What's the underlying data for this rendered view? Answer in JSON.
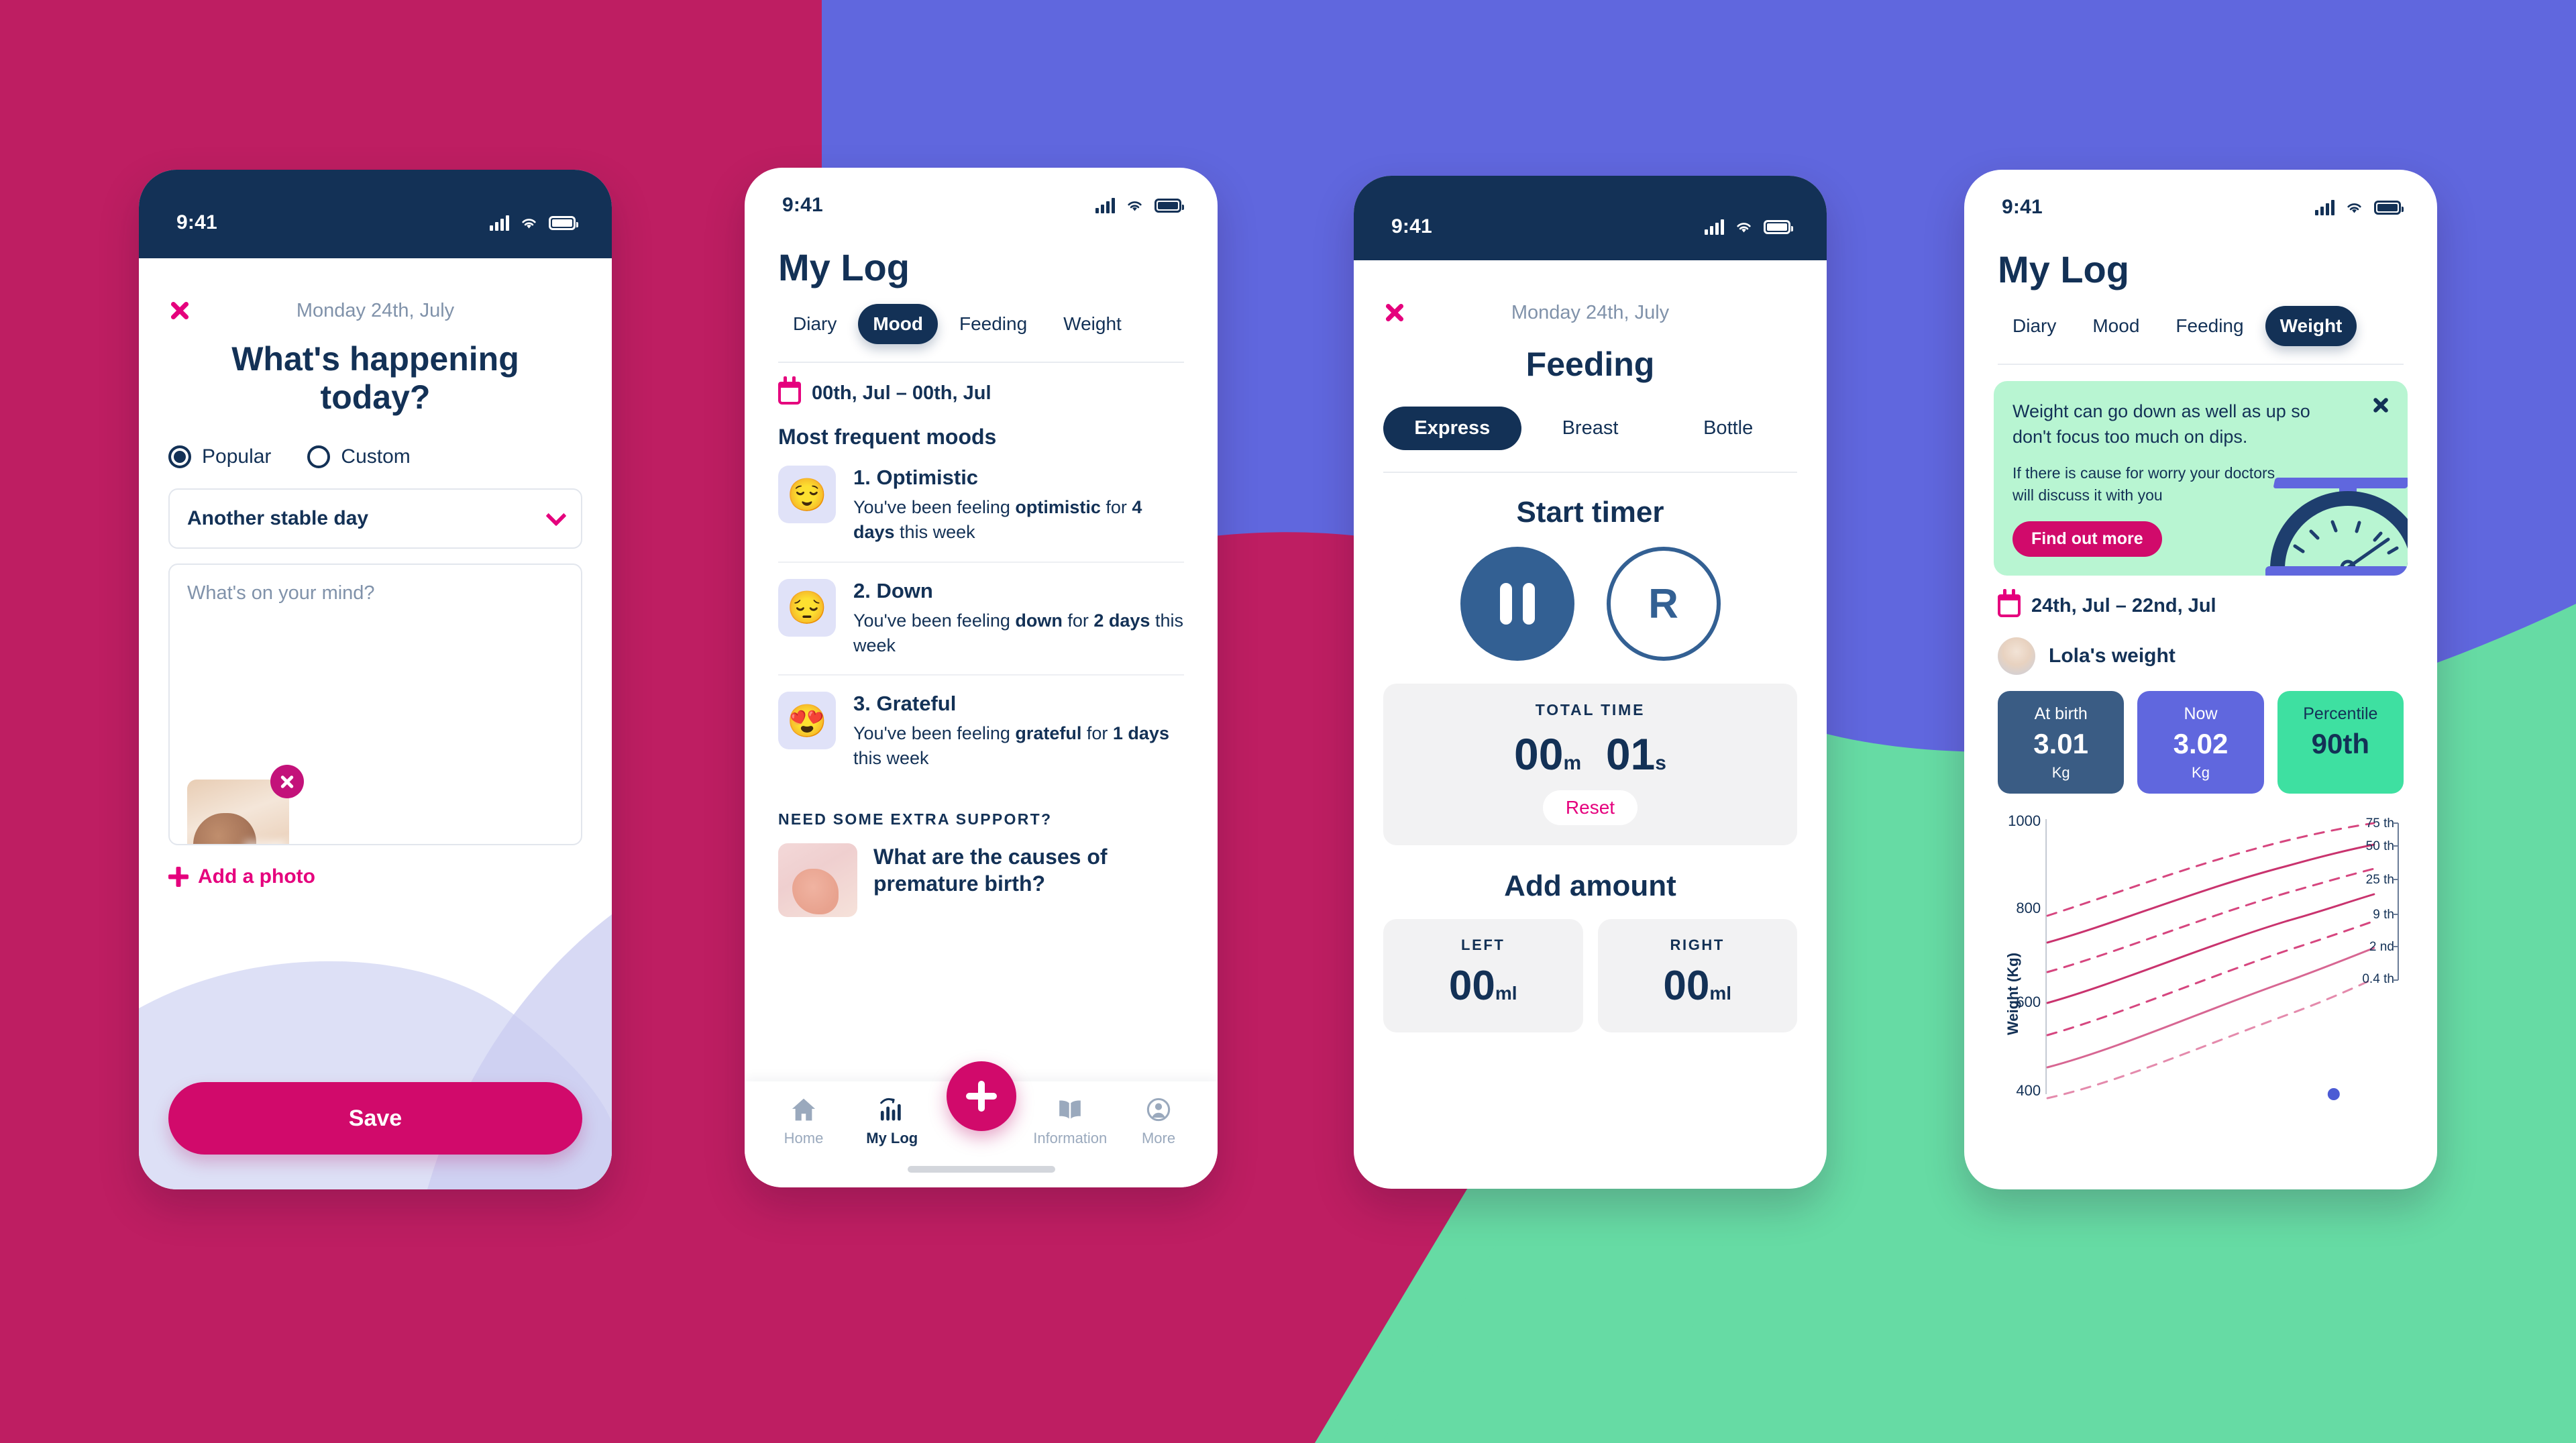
{
  "palette": {
    "pink": "#BE1E62",
    "purple": "#6067DE",
    "green": "#66DBA4",
    "navy": "#133156",
    "magenta": "#E5007D",
    "lilac": "#C9CCF0"
  },
  "statusbar": {
    "time": "9:41",
    "icons": [
      "signal-icon",
      "wifi-icon",
      "battery-icon"
    ]
  },
  "phone1": {
    "date": "Monday 24th, July",
    "close_label": "close-icon",
    "title": "What's happening today?",
    "options": [
      {
        "label": "Popular",
        "selected": true
      },
      {
        "label": "Custom",
        "selected": false
      }
    ],
    "select": {
      "value": "Another stable day"
    },
    "note": {
      "placeholder": "What's on your mind?"
    },
    "photo": {
      "remove_label": "remove-photo",
      "alt": "sleeping newborn baby"
    },
    "add_photo_label": "Add a photo",
    "save_label": "Save"
  },
  "phone2": {
    "title": "My Log",
    "tabs": [
      {
        "label": "Diary",
        "active": false
      },
      {
        "label": "Mood",
        "active": true
      },
      {
        "label": "Feeding",
        "active": false
      },
      {
        "label": "Weight",
        "active": false
      }
    ],
    "date_range": "00th, Jul – 00th, Jul",
    "section_title": "Most frequent moods",
    "moods": [
      {
        "rank": "1. Optimistic",
        "emoji": "😌",
        "desc_pre": "You've been feeling ",
        "desc_bold": "optimistic",
        "desc_mid": " for ",
        "desc_days": "4 days",
        "desc_post": " this week"
      },
      {
        "rank": "2. Down",
        "emoji": "😔",
        "desc_pre": "You've been feeling ",
        "desc_bold": "down",
        "desc_mid": " for ",
        "desc_days": "2 days",
        "desc_post": " this week"
      },
      {
        "rank": "3. Grateful",
        "emoji": "😍",
        "desc_pre": "You've been feeling ",
        "desc_bold": "grateful",
        "desc_mid": " for ",
        "desc_days": "1 days",
        "desc_post": " this week"
      }
    ],
    "support_kicker": "NEED SOME EXTRA SUPPORT?",
    "article_title": "What are the causes of premature birth?",
    "tabbar": [
      {
        "label": "Home",
        "icon": "home-icon",
        "active": false
      },
      {
        "label": "My Log",
        "icon": "chart-icon",
        "active": true
      },
      {
        "label": "Information",
        "icon": "book-icon",
        "active": false
      },
      {
        "label": "More",
        "icon": "profile-icon",
        "active": false
      }
    ],
    "fab_label": "add-entry"
  },
  "phone3": {
    "date": "Monday 24th, July",
    "title": "Feeding",
    "segments": [
      {
        "label": "Express",
        "active": true
      },
      {
        "label": "Breast",
        "active": false
      },
      {
        "label": "Bottle",
        "active": false
      }
    ],
    "timer_heading": "Start timer",
    "pause_label": "pause-icon",
    "side_label": "R",
    "total_time_label": "TOTAL TIME",
    "minutes": "00",
    "minutes_unit": "m",
    "seconds": "01",
    "seconds_unit": "s",
    "reset_label": "Reset",
    "add_amount_heading": "Add amount",
    "amounts": [
      {
        "label": "LEFT",
        "value": "00",
        "unit": "ml"
      },
      {
        "label": "RIGHT",
        "value": "00",
        "unit": "ml"
      }
    ]
  },
  "phone4": {
    "title": "My Log",
    "tabs": [
      {
        "label": "Diary",
        "active": false
      },
      {
        "label": "Mood",
        "active": false
      },
      {
        "label": "Feeding",
        "active": false
      },
      {
        "label": "Weight",
        "active": true
      }
    ],
    "promo": {
      "heading": "Weight can go down as well as up so don't focus too much on dips.",
      "body": "If there is cause for worry your doctors will discuss it with you",
      "button": "Find out more",
      "close_label": "dismiss-banner",
      "art": "kitchen-scale-illustration"
    },
    "date_range": "24th, Jul – 22nd, Jul",
    "baby_name": "Lola's weight",
    "stats": [
      {
        "key": "At birth",
        "value": "3.01",
        "unit": "Kg",
        "bg": "#3A5C84",
        "fg": "#FFFFFF"
      },
      {
        "key": "Now",
        "value": "3.02",
        "unit": "Kg",
        "bg": "#6067DE",
        "fg": "#FFFFFF"
      },
      {
        "key": "Percentile",
        "value": "90th",
        "unit": "",
        "bg": "#3EE0A1",
        "fg": "#133156"
      }
    ],
    "chart_data": {
      "type": "line",
      "title": "",
      "xlabel": "",
      "ylabel": "Weight (Kg)",
      "yticks": [
        1000,
        800,
        600,
        400
      ],
      "ylim": [
        400,
        1050
      ],
      "grid": false,
      "legend_position": "right",
      "series": [
        {
          "name": "75 th",
          "style": "dashed",
          "color": "#D6467F"
        },
        {
          "name": "50 th",
          "style": "solid",
          "color": "#C9336E"
        },
        {
          "name": "25 th",
          "style": "dashed",
          "color": "#D6467F"
        },
        {
          "name": "9 th",
          "style": "solid",
          "color": "#C9336E"
        },
        {
          "name": "2 nd",
          "style": "dashed",
          "color": "#D6467F"
        },
        {
          "name": "0.4 th",
          "style": "solid",
          "color": "#E48AAC"
        }
      ],
      "point": {
        "label": "",
        "color": "#4C5BD4"
      }
    }
  }
}
